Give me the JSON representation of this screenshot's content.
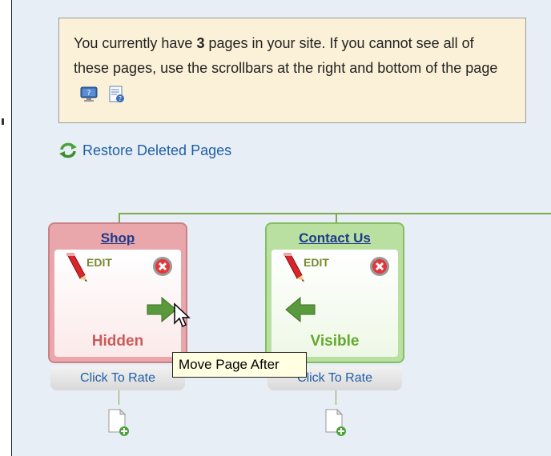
{
  "info": {
    "prefix": "You currently have ",
    "page_count": "3",
    "suffix": " pages in your site. If you cannot see all of these pages, use the scrollbars at the right and bottom of the page"
  },
  "restore": {
    "label": "Restore Deleted Pages"
  },
  "pages": [
    {
      "title": "Shop",
      "edit_label": "EDIT",
      "status": "Hidden",
      "rate_label": "Click To Rate",
      "arrow": "right",
      "accent": "#e39a9e",
      "status_color": "#cc5a5a"
    },
    {
      "title": "Contact Us",
      "edit_label": "EDIT",
      "status": "Visible",
      "rate_label": "Click To Rate",
      "arrow": "left",
      "accent": "#a6d38a",
      "status_color": "#63a82c"
    }
  ],
  "tooltip": {
    "text": "Move Page After"
  }
}
